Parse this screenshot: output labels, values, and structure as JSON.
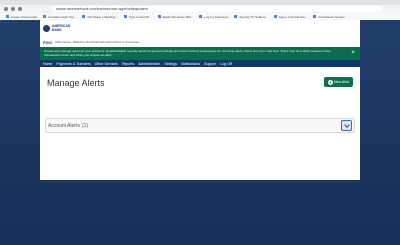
{
  "browser": {
    "url": "secure.americanbank.com/business/user-app#/settings/alerts",
    "bookmarks": [
      "Career Cloud Login",
      "Consider Login Typ...",
      "GS Chase 1 Banking...",
      "Type to Search...",
      "Watch the Game 200...",
      "Log in | Adventure",
      "Agency TO Settlem...",
      "Log in | Central Gla...",
      "Compliance System"
    ]
  },
  "app": {
    "logo_line1": "AMERICAN",
    "logo_line2": "BANK",
    "fdic_mark": "FDIC",
    "fdic_text": "FDIC-Insured - Backed by the full faith and credit of the U.S. Government",
    "banner_text": "Create and manage alerts for your accounts. Enable/disable security alerts for account activity and select delivery preferences for receiving alerts. Alerts are not in real time. There may be a delay between when transactions occur and when you receive an alert.",
    "nav": [
      "Home",
      "Payments & Transfers",
      "Other Services",
      "Reports",
      "Administration",
      "Settings",
      "Notifications",
      "Support",
      "Log Off"
    ],
    "page_title": "Manage Alerts",
    "new_alert_label": "New Alert",
    "account_alerts_label": "Account Alerts",
    "account_alerts_count": "(1)",
    "colors": {
      "accent": "#0e6f50",
      "nav_bg": "#123a69",
      "page_bg": "#1e3a63"
    }
  }
}
